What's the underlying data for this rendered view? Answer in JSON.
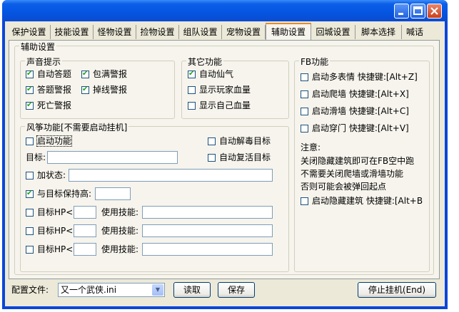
{
  "tabs": [
    "保护设置",
    "技能设置",
    "怪物设置",
    "捡物设置",
    "组队设置",
    "宠物设置",
    "辅助设置",
    "回城设置",
    "脚本选择",
    "喊话"
  ],
  "active_tab": "辅助设置",
  "panel_title": "辅助设置",
  "sound": {
    "title": "声音提示",
    "items": [
      {
        "label": "自动答题",
        "checked": true
      },
      {
        "label": "包满警报",
        "checked": true
      },
      {
        "label": "答题警报",
        "checked": true
      },
      {
        "label": "掉线警报",
        "checked": true
      },
      {
        "label": "死亡警报",
        "checked": true
      }
    ]
  },
  "other": {
    "title": "其它功能",
    "items": [
      {
        "label": "自动仙气",
        "checked": true
      },
      {
        "label": "显示玩家血量",
        "checked": false
      },
      {
        "label": "显示自己血量",
        "checked": false
      }
    ]
  },
  "kite": {
    "title": "风筝功能[不需要启动挂机]",
    "enable_label": "启动功能",
    "auto_detox_label": "自动解毒目标",
    "target_label": "目标:",
    "auto_revive_label": "自动复活目标",
    "add_state_label": "加状态:",
    "keep_distance_label": "与目标保持高:",
    "hp_label": "目标HP<",
    "skill_label": "使用技能:",
    "checked": {
      "enable": false,
      "auto_detox": false,
      "auto_revive": false,
      "add_state": false,
      "keep_distance": true,
      "hp1": false,
      "hp2": false,
      "hp3": false
    }
  },
  "fb": {
    "title": "FB功能",
    "items": [
      {
        "label": "启动多表情 快捷键:[Alt+Z]",
        "checked": false
      },
      {
        "label": "启动爬墙 快捷键:[Alt+X]",
        "checked": false
      },
      {
        "label": "启动滑墙 快捷键:[Alt+C]",
        "checked": false
      },
      {
        "label": "启动穿门 快捷键:[Alt+V]",
        "checked": false
      }
    ],
    "note_title": "注意:",
    "note_lines": [
      "关闭隐藏建筑即可在FB空中跑",
      "不需要关闭爬墙或滑墙功能",
      "否则可能会被弹回起点"
    ],
    "hide_building_label": "启动隐藏建筑 快捷键:[Alt+B",
    "hide_building_checked": false
  },
  "footer": {
    "config_label": "配置文件:",
    "config_value": "又一个武侠.ini",
    "read_button": "读取",
    "save_button": "保存",
    "stop_button": "停止挂机(End)"
  }
}
